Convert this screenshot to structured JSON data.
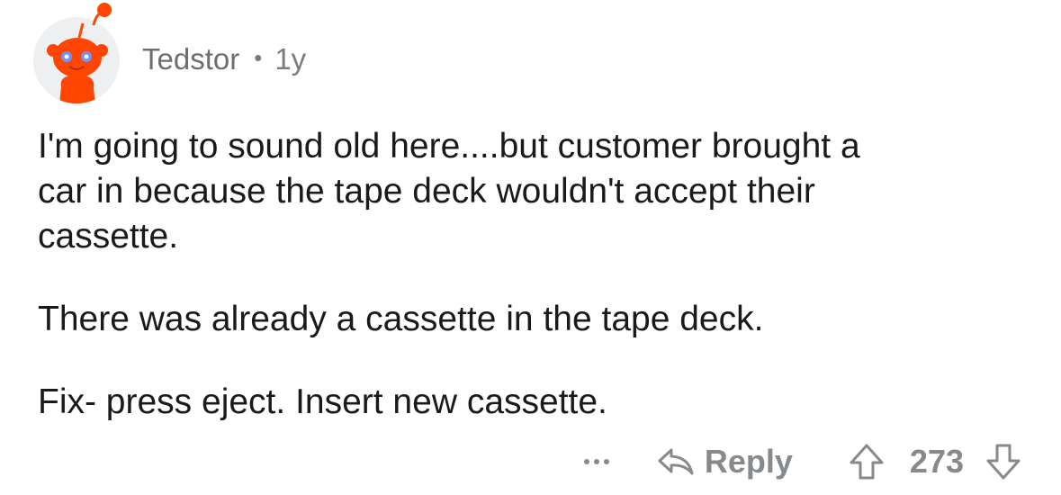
{
  "comment": {
    "author": "Tedstor",
    "separator": "•",
    "age": "1y",
    "paragraphs": [
      "I'm going to sound old here....but customer brought a\ncar in because the tape deck wouldn't accept their\ncassette.",
      "There was already a cassette in the tape deck.",
      "Fix- press eject. Insert new cassette."
    ],
    "actions": {
      "more_icon": "more-options-icon",
      "reply_icon": "reply-arrow-icon",
      "reply_label": "Reply",
      "upvote_icon": "upvote-arrow-icon",
      "score": "273",
      "downvote_icon": "downvote-arrow-icon"
    }
  },
  "colors": {
    "avatar_bg": "#edeff1",
    "snoo_red": "#ff4500",
    "snoo_eye": "#7193ff",
    "meta_gray": "#7c7c7c",
    "action_gray": "#878a8c",
    "text": "#1a1a1b"
  }
}
